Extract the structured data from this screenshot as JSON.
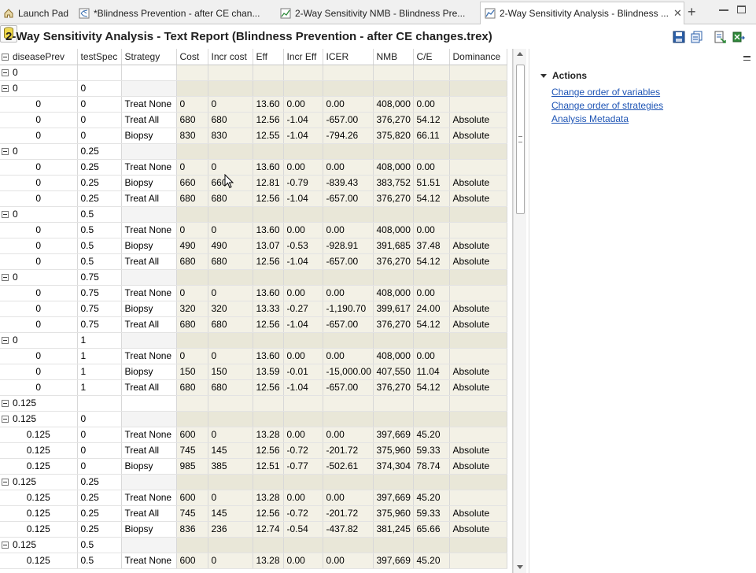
{
  "tabs": [
    {
      "label": "Launch Pad",
      "icon": "home-icon",
      "active": false
    },
    {
      "label": "*Blindness Prevention - after CE chan...",
      "icon": "tree-model-icon",
      "active": false
    },
    {
      "label": "2-Way Sensitivity NMB - Blindness Pre...",
      "icon": "chart-icon",
      "active": false
    },
    {
      "label": "2-Way Sensitivity Analysis - Blindness ...",
      "icon": "report-icon",
      "active": true
    }
  ],
  "header": {
    "title": "2-Way Sensitivity Analysis - Text Report (Blindness Prevention - after CE changes.trex)"
  },
  "table": {
    "columns": [
      "diseasePrev",
      "testSpec",
      "Strategy",
      "Cost",
      "Incr cost",
      "Eff",
      "Incr Eff",
      "ICER",
      "NMB",
      "C/E",
      "Dominance"
    ],
    "rows": [
      {
        "type": "g1",
        "c": [
          "0",
          "",
          "",
          "",
          "",
          "",
          "",
          "",
          "",
          "",
          ""
        ]
      },
      {
        "type": "g2",
        "c": [
          "0",
          "0",
          "",
          "",
          "",
          "",
          "",
          "",
          "",
          "",
          ""
        ]
      },
      {
        "type": "leaf",
        "c": [
          "0",
          "0",
          "Treat None",
          "0",
          "0",
          "13.60",
          "0.00",
          "0.00",
          "408,000",
          "0.00",
          ""
        ]
      },
      {
        "type": "leaf",
        "c": [
          "0",
          "0",
          "Treat All",
          "680",
          "680",
          "12.56",
          "-1.04",
          "-657.00",
          "376,270",
          "54.12",
          "Absolute"
        ]
      },
      {
        "type": "leaf",
        "c": [
          "0",
          "0",
          "Biopsy",
          "830",
          "830",
          "12.55",
          "-1.04",
          "-794.26",
          "375,820",
          "66.11",
          "Absolute"
        ]
      },
      {
        "type": "g2",
        "c": [
          "0",
          "0.25",
          "",
          "",
          "",
          "",
          "",
          "",
          "",
          "",
          ""
        ]
      },
      {
        "type": "leaf",
        "c": [
          "0",
          "0.25",
          "Treat None",
          "0",
          "0",
          "13.60",
          "0.00",
          "0.00",
          "408,000",
          "0.00",
          ""
        ]
      },
      {
        "type": "leaf",
        "c": [
          "0",
          "0.25",
          "Biopsy",
          "660",
          "660",
          "12.81",
          "-0.79",
          "-839.43",
          "383,752",
          "51.51",
          "Absolute"
        ]
      },
      {
        "type": "leaf",
        "c": [
          "0",
          "0.25",
          "Treat All",
          "680",
          "680",
          "12.56",
          "-1.04",
          "-657.00",
          "376,270",
          "54.12",
          "Absolute"
        ]
      },
      {
        "type": "g2",
        "c": [
          "0",
          "0.5",
          "",
          "",
          "",
          "",
          "",
          "",
          "",
          "",
          ""
        ]
      },
      {
        "type": "leaf",
        "c": [
          "0",
          "0.5",
          "Treat None",
          "0",
          "0",
          "13.60",
          "0.00",
          "0.00",
          "408,000",
          "0.00",
          ""
        ]
      },
      {
        "type": "leaf",
        "c": [
          "0",
          "0.5",
          "Biopsy",
          "490",
          "490",
          "13.07",
          "-0.53",
          "-928.91",
          "391,685",
          "37.48",
          "Absolute"
        ]
      },
      {
        "type": "leaf",
        "c": [
          "0",
          "0.5",
          "Treat All",
          "680",
          "680",
          "12.56",
          "-1.04",
          "-657.00",
          "376,270",
          "54.12",
          "Absolute"
        ]
      },
      {
        "type": "g2",
        "c": [
          "0",
          "0.75",
          "",
          "",
          "",
          "",
          "",
          "",
          "",
          "",
          ""
        ]
      },
      {
        "type": "leaf",
        "c": [
          "0",
          "0.75",
          "Treat None",
          "0",
          "0",
          "13.60",
          "0.00",
          "0.00",
          "408,000",
          "0.00",
          ""
        ]
      },
      {
        "type": "leaf",
        "c": [
          "0",
          "0.75",
          "Biopsy",
          "320",
          "320",
          "13.33",
          "-0.27",
          "-1,190.70",
          "399,617",
          "24.00",
          "Absolute"
        ]
      },
      {
        "type": "leaf",
        "c": [
          "0",
          "0.75",
          "Treat All",
          "680",
          "680",
          "12.56",
          "-1.04",
          "-657.00",
          "376,270",
          "54.12",
          "Absolute"
        ]
      },
      {
        "type": "g2",
        "c": [
          "0",
          "1",
          "",
          "",
          "",
          "",
          "",
          "",
          "",
          "",
          ""
        ]
      },
      {
        "type": "leaf",
        "c": [
          "0",
          "1",
          "Treat None",
          "0",
          "0",
          "13.60",
          "0.00",
          "0.00",
          "408,000",
          "0.00",
          ""
        ]
      },
      {
        "type": "leaf",
        "c": [
          "0",
          "1",
          "Biopsy",
          "150",
          "150",
          "13.59",
          "-0.01",
          "-15,000.00",
          "407,550",
          "11.04",
          "Absolute"
        ]
      },
      {
        "type": "leaf",
        "c": [
          "0",
          "1",
          "Treat All",
          "680",
          "680",
          "12.56",
          "-1.04",
          "-657.00",
          "376,270",
          "54.12",
          "Absolute"
        ]
      },
      {
        "type": "g1",
        "c": [
          "0.125",
          "",
          "",
          "",
          "",
          "",
          "",
          "",
          "",
          "",
          ""
        ]
      },
      {
        "type": "g2",
        "c": [
          "0.125",
          "0",
          "",
          "",
          "",
          "",
          "",
          "",
          "",
          "",
          ""
        ]
      },
      {
        "type": "leaf",
        "c": [
          "0.125",
          "0",
          "Treat None",
          "600",
          "0",
          "13.28",
          "0.00",
          "0.00",
          "397,669",
          "45.20",
          ""
        ]
      },
      {
        "type": "leaf",
        "c": [
          "0.125",
          "0",
          "Treat All",
          "745",
          "145",
          "12.56",
          "-0.72",
          "-201.72",
          "375,960",
          "59.33",
          "Absolute"
        ]
      },
      {
        "type": "leaf",
        "c": [
          "0.125",
          "0",
          "Biopsy",
          "985",
          "385",
          "12.51",
          "-0.77",
          "-502.61",
          "374,304",
          "78.74",
          "Absolute"
        ]
      },
      {
        "type": "g2",
        "c": [
          "0.125",
          "0.25",
          "",
          "",
          "",
          "",
          "",
          "",
          "",
          "",
          ""
        ]
      },
      {
        "type": "leaf",
        "c": [
          "0.125",
          "0.25",
          "Treat None",
          "600",
          "0",
          "13.28",
          "0.00",
          "0.00",
          "397,669",
          "45.20",
          ""
        ]
      },
      {
        "type": "leaf",
        "c": [
          "0.125",
          "0.25",
          "Treat All",
          "745",
          "145",
          "12.56",
          "-0.72",
          "-201.72",
          "375,960",
          "59.33",
          "Absolute"
        ]
      },
      {
        "type": "leaf",
        "c": [
          "0.125",
          "0.25",
          "Biopsy",
          "836",
          "236",
          "12.74",
          "-0.54",
          "-437.82",
          "381,245",
          "65.66",
          "Absolute"
        ]
      },
      {
        "type": "g2",
        "c": [
          "0.125",
          "0.5",
          "",
          "",
          "",
          "",
          "",
          "",
          "",
          "",
          ""
        ]
      },
      {
        "type": "leaf",
        "c": [
          "0.125",
          "0.5",
          "Treat None",
          "600",
          "0",
          "13.28",
          "0.00",
          "0.00",
          "397,669",
          "45.20",
          ""
        ]
      }
    ]
  },
  "actions": {
    "title": "Actions",
    "links": [
      "Change order of variables",
      "Change order of strategies",
      "Analysis Metadata"
    ]
  },
  "colors": {
    "link": "#1f55b5",
    "data_cell_bg": "#f3f1e6",
    "group_data_cell_bg": "#e9e7d8"
  }
}
